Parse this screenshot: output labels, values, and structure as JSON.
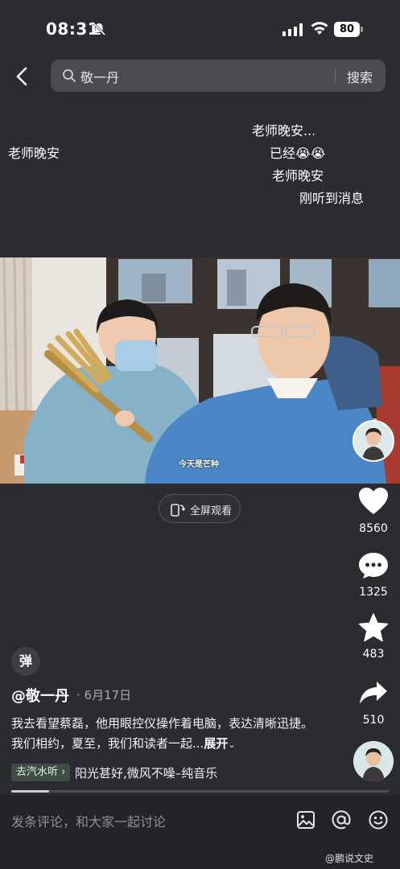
{
  "status": {
    "time": "08:31",
    "battery": "80"
  },
  "search": {
    "query": "敬一丹",
    "button": "搜索"
  },
  "danmaku": [
    "老师晚安",
    "老师晚安...",
    "已经😭😭",
    "老师晚安",
    "刚听到消息"
  ],
  "video": {
    "caption": "今天是芒种"
  },
  "fullscreen": {
    "label": "全屏观看"
  },
  "actions": {
    "likes": "8560",
    "comments": "1325",
    "favorites": "483",
    "shares": "510"
  },
  "post": {
    "danmu_toggle": "弹",
    "author": "@敬一丹",
    "date": "· 6月17日",
    "description": "我去看望蔡磊，他用眼控仪操作着电脑，表达清晰迅捷。我们相约，夏至，我们和读者一起...",
    "expand": "展开",
    "music_tag": "去汽水听",
    "music_title": "阳光甚好,微风不噪–纯音乐",
    "progress": 0.1
  },
  "comment_bar": {
    "placeholder": "发条评论，和大家一起讨论"
  },
  "watermark": "@鹏说文史",
  "colors": {
    "background": "#2a2c31",
    "search_bg": "#4a4c51",
    "bar_bg": "#232428"
  }
}
